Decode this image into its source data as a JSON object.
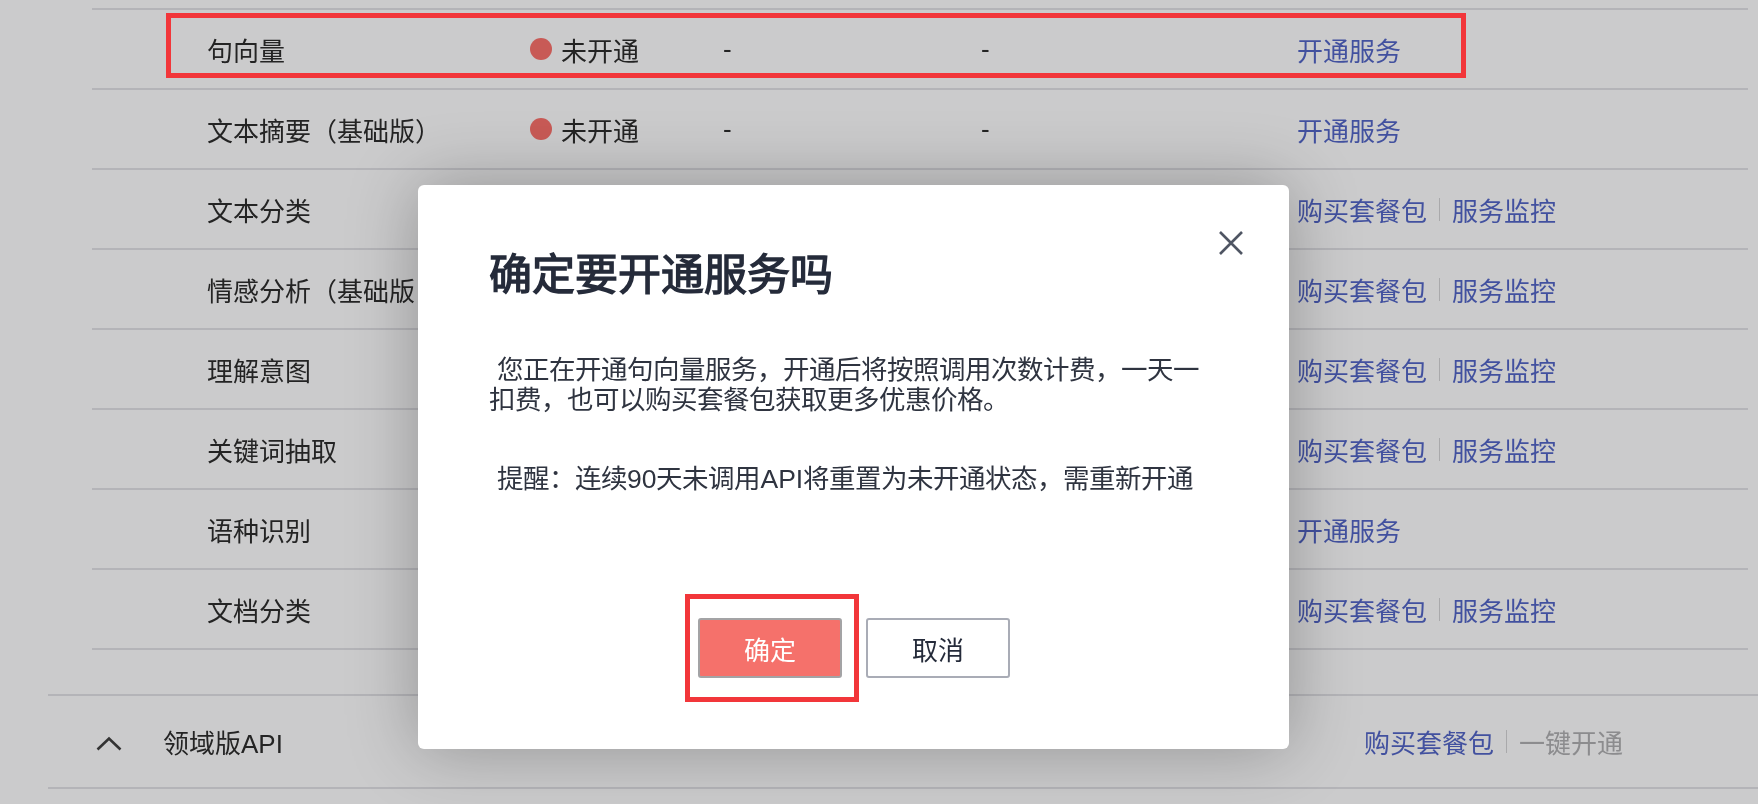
{
  "rows": [
    {
      "name": "句向量",
      "highlighted": true,
      "status": {
        "text": "未开通",
        "color": "#c85a56"
      },
      "column_3": "-",
      "column_4": "-",
      "actions": [
        {
          "label": "开通服务",
          "disabled": false
        }
      ]
    },
    {
      "name": "文本摘要（基础版）",
      "highlighted": false,
      "status": {
        "text": "未开通",
        "color": "#c85a56"
      },
      "column_3": "-",
      "column_4": "-",
      "actions": [
        {
          "label": "开通服务",
          "disabled": false
        }
      ]
    },
    {
      "name": "文本分类",
      "highlighted": false,
      "actions": [
        {
          "label": "购买套餐包",
          "disabled": false
        },
        {
          "label": "服务监控",
          "disabled": false
        }
      ]
    },
    {
      "name": "情感分析（基础版",
      "highlighted": false,
      "actions": [
        {
          "label": "购买套餐包",
          "disabled": false
        },
        {
          "label": "服务监控",
          "disabled": false
        }
      ]
    },
    {
      "name": "理解意图",
      "highlighted": false,
      "actions": [
        {
          "label": "购买套餐包",
          "disabled": false
        },
        {
          "label": "服务监控",
          "disabled": false
        }
      ]
    },
    {
      "name": "关键词抽取",
      "highlighted": false,
      "actions": [
        {
          "label": "购买套餐包",
          "disabled": false
        },
        {
          "label": "服务监控",
          "disabled": false
        }
      ]
    },
    {
      "name": "语种识别",
      "highlighted": false,
      "actions": [
        {
          "label": "开通服务",
          "disabled": false
        }
      ]
    },
    {
      "name": "文档分类",
      "highlighted": false,
      "actions": [
        {
          "label": "购买套餐包",
          "disabled": false
        },
        {
          "label": "服务监控",
          "disabled": false
        }
      ]
    }
  ],
  "section": {
    "title": "领域版API",
    "expanded": true,
    "actions": [
      {
        "label": "购买套餐包",
        "disabled": false
      },
      {
        "label": "一键开通",
        "disabled": true
      }
    ]
  },
  "modal": {
    "title": "确定要开通服务吗",
    "paragraphs": [
      "您正在开通句向量服务，开通后将按照调用次数计费，一天一扣费，也可以购买套餐包获取更多优惠价格。",
      "提醒：连续90天未调用API将重置为未开通状态，需重新开通"
    ],
    "buttons": [
      {
        "label": "确定",
        "kind": "primary",
        "highlighted": true
      },
      {
        "label": "取消",
        "kind": "secondary",
        "highlighted": false
      }
    ]
  }
}
